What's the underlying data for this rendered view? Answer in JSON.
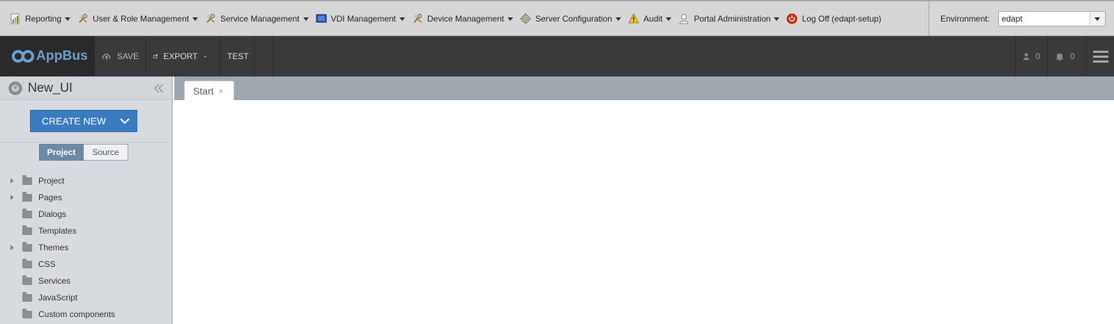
{
  "portal_menu": {
    "items": [
      {
        "label": "Reporting",
        "icon": "report-chart-icon"
      },
      {
        "label": "User & Role Management",
        "icon": "tools-icon"
      },
      {
        "label": "Service Management",
        "icon": "tools-icon"
      },
      {
        "label": "VDI Management",
        "icon": "monitor-icon"
      },
      {
        "label": "Device Management",
        "icon": "tools-icon"
      },
      {
        "label": "Server Configuration",
        "icon": "gear-icon"
      },
      {
        "label": "Audit",
        "icon": "warning-icon"
      },
      {
        "label": "Portal Administration",
        "icon": "user-icon"
      }
    ],
    "logoff_label": "Log Off (edapt-setup)",
    "environment_label": "Environment:",
    "environment_value": "edapt"
  },
  "toolbar": {
    "logo_text": "AppBus",
    "save_label": "SAVE",
    "export_label": "EXPORT",
    "test_label": "TEST",
    "users_count": "0",
    "notifications_count": "0"
  },
  "sidebar": {
    "project_name": "New_UI",
    "create_new_label": "CREATE NEW",
    "view_tabs": [
      {
        "label": "Project",
        "active": true
      },
      {
        "label": "Source",
        "active": false
      }
    ],
    "tree": [
      {
        "label": "Project",
        "expandable": true
      },
      {
        "label": "Pages",
        "expandable": true
      },
      {
        "label": "Dialogs",
        "expandable": false
      },
      {
        "label": "Templates",
        "expandable": false
      },
      {
        "label": "Themes",
        "expandable": true
      },
      {
        "label": "CSS",
        "expandable": false
      },
      {
        "label": "Services",
        "expandable": false
      },
      {
        "label": "JavaScript",
        "expandable": false
      },
      {
        "label": "Custom components",
        "expandable": false
      }
    ]
  },
  "main": {
    "tabs": [
      {
        "label": "Start",
        "close_symbol": "×"
      }
    ]
  },
  "colors": {
    "accent": "#3b7bbf",
    "logo": "#6d9fd0",
    "toolbar_bg": "#3a3a3a",
    "logoff_red": "#cc2200"
  }
}
